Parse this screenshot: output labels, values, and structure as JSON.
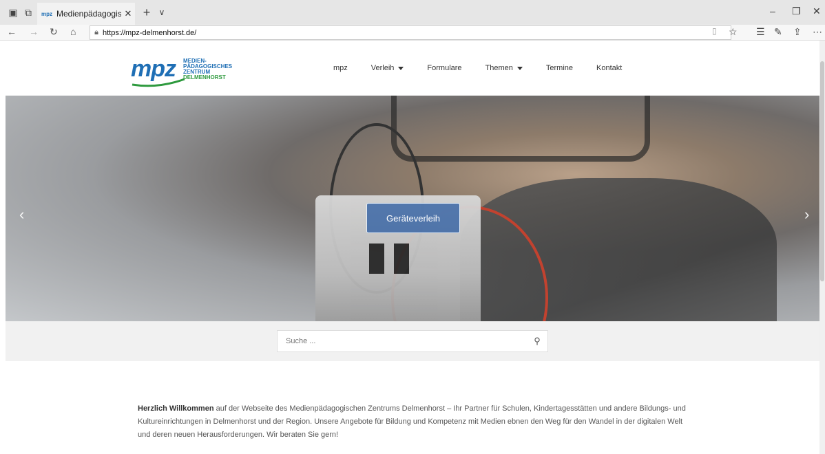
{
  "browser": {
    "tab_title": "Medienpädagogisches Z",
    "favicon_text": "mpz",
    "url": "https://mpz-delmenhorst.de/",
    "new_tab_label": "+",
    "tab_menu_label": "∨"
  },
  "site": {
    "logo": {
      "mpz": "mpz",
      "line1": "MEDIEN-",
      "line2": "PÄDAGOGISCHES",
      "line3": "ZENTRUM",
      "line4": "DELMENHORST"
    },
    "menu": [
      {
        "label": "mpz",
        "dropdown": false
      },
      {
        "label": "Verleih",
        "dropdown": true
      },
      {
        "label": "Formulare",
        "dropdown": false
      },
      {
        "label": "Themen",
        "dropdown": true
      },
      {
        "label": "Termine",
        "dropdown": false
      },
      {
        "label": "Kontakt",
        "dropdown": false
      }
    ]
  },
  "hero": {
    "label": "Geräteverleih",
    "prev_arrow": "‹",
    "next_arrow": "›"
  },
  "search": {
    "placeholder": "Suche ..."
  },
  "intro": {
    "bold": "Herzlich Willkommen",
    "text": " auf der Webseite des Medienpädagogischen Zentrums Delmenhorst – Ihr Partner für Schulen, Kindertagesstätten und andere Bildungs- und Kultureinrichtungen in Delmenhorst und der Region. Unsere Angebote für Bildung und Kompetenz mit Medien ebnen den Weg für den Wandel in der digitalen Welt und deren neuen Herausforderungen. Wir beraten Sie gern!"
  },
  "colors": {
    "brand_blue": "#1f6fb5",
    "brand_green": "#2e9a3e",
    "hero_label_bg": "#285aa0"
  }
}
